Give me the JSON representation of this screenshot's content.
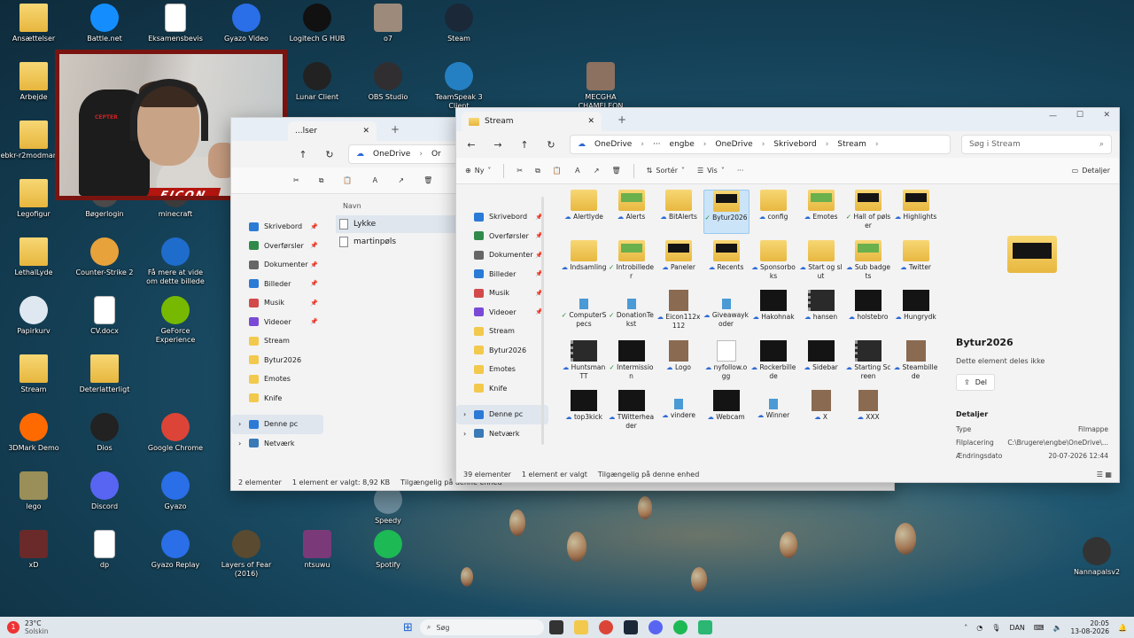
{
  "desktop": {
    "icons": [
      {
        "label": "Ansættelser",
        "kind": "folder",
        "color": "#f2c94c"
      },
      {
        "label": "Battle.net",
        "kind": "app",
        "color": "#148eff"
      },
      {
        "label": "Eksamensbevis",
        "kind": "doc",
        "color": "#ffffff"
      },
      {
        "label": "Gyazo Video",
        "kind": "app",
        "color": "#2a6ee8"
      },
      {
        "label": "Logitech G HUB",
        "kind": "app",
        "color": "#111111"
      },
      {
        "label": "o7",
        "kind": "image",
        "color": "#9d8a7a"
      },
      {
        "label": "Steam",
        "kind": "app",
        "color": "#1b2838"
      },
      {
        "label": "Arbejde",
        "kind": "folder",
        "color": "#f2c94c"
      },
      {
        "label": "Lunar Client",
        "kind": "app",
        "color": "#222222"
      },
      {
        "label": "OBS Studio",
        "kind": "app",
        "color": "#302e31"
      },
      {
        "label": "TeamSpeak 3 Client",
        "kind": "app",
        "color": "#2580c3"
      },
      {
        "label": "MECGHA CHAMELEON",
        "kind": "image",
        "color": "#8c7060"
      },
      {
        "label": "ebkr-r2modman-...",
        "kind": "folder",
        "color": "#f2c94c"
      },
      {
        "label": "Legofigur",
        "kind": "folder",
        "color": "#d9b24a"
      },
      {
        "label": "Bøgerlogin",
        "kind": "app",
        "color": "#4a4a4a"
      },
      {
        "label": "minecraft",
        "kind": "app",
        "color": "#3b3b3b"
      },
      {
        "label": "LethalLyde",
        "kind": "folder",
        "color": "#f2c94c"
      },
      {
        "label": "Counter-Strike 2",
        "kind": "app",
        "color": "#e8a23b"
      },
      {
        "label": "Få mere at vide om dette billede",
        "kind": "app",
        "color": "#1e6ccc"
      },
      {
        "label": "Papirkurv",
        "kind": "app",
        "color": "#dfe8f0"
      },
      {
        "label": "CV.docx",
        "kind": "doc",
        "color": "#ffffff"
      },
      {
        "label": "GeForce Experience",
        "kind": "app",
        "color": "#76b900"
      },
      {
        "label": "Stream",
        "kind": "folder",
        "color": "#f2c94c"
      },
      {
        "label": "Deterlatterligt",
        "kind": "folder",
        "color": "#f2c94c"
      },
      {
        "label": "3DMark Demo",
        "kind": "app",
        "color": "#ff6a00"
      },
      {
        "label": "Dios",
        "kind": "app",
        "color": "#222222"
      },
      {
        "label": "Google Chrome",
        "kind": "app",
        "color": "#db4437"
      },
      {
        "label": "lego",
        "kind": "image",
        "color": "#9a8f58"
      },
      {
        "label": "Discord",
        "kind": "app",
        "color": "#5865f2"
      },
      {
        "label": "Gyazo",
        "kind": "app",
        "color": "#2a6ee8"
      },
      {
        "label": "xD",
        "kind": "image",
        "color": "#6a2a2a"
      },
      {
        "label": "dp",
        "kind": "doc",
        "color": "#ffffff"
      },
      {
        "label": "Gyazo Replay",
        "kind": "app",
        "color": "#2a6ee8"
      },
      {
        "label": "Layers of Fear (2016)",
        "kind": "app",
        "color": "#5a4a30"
      },
      {
        "label": "ntsuwu",
        "kind": "image",
        "color": "#7a3a7a"
      },
      {
        "label": "Spotify",
        "kind": "app",
        "color": "#1db954"
      },
      {
        "label": "Speedy",
        "kind": "app",
        "color": "#6a8a9a"
      },
      {
        "label": "Nannapalsv2",
        "kind": "app",
        "color": "#333333"
      }
    ]
  },
  "webcam": {
    "tag": "EICON"
  },
  "back_window": {
    "tab_title": "...lser",
    "breadcrumb": [
      "OneDrive",
      "Or"
    ],
    "column_header": "Navn",
    "files": [
      "Lykke",
      "martinpøls"
    ],
    "sidebar": [
      {
        "label": "Skrivebord",
        "pinned": true,
        "icon": "#2a7ad6"
      },
      {
        "label": "Overførsler",
        "pinned": true,
        "icon": "#2f8a4a"
      },
      {
        "label": "Dokumenter",
        "pinned": true,
        "icon": "#666666"
      },
      {
        "label": "Billeder",
        "pinned": true,
        "icon": "#2a7ad6"
      },
      {
        "label": "Musik",
        "pinned": true,
        "icon": "#d24a4a"
      },
      {
        "label": "Videoer",
        "pinned": true,
        "icon": "#7a4ad6"
      },
      {
        "label": "Stream",
        "pinned": false,
        "icon": "#f2c94c"
      },
      {
        "label": "Bytur2026",
        "pinned": false,
        "icon": "#f2c94c"
      },
      {
        "label": "Emotes",
        "pinned": false,
        "icon": "#f2c94c"
      },
      {
        "label": "Knife",
        "pinned": false,
        "icon": "#f2c94c"
      }
    ],
    "this_pc": "Denne pc",
    "network": "Netværk",
    "status": {
      "count": "2 elementer",
      "selected": "1 element er valgt: 8,92 KB",
      "availability": "Tilgængelig på denne enhed"
    }
  },
  "window": {
    "tab_title": "Stream",
    "new_tab": "+",
    "breadcrumb": [
      "OneDrive",
      "···",
      "engbe",
      "OneDrive",
      "Skrivebord",
      "Stream"
    ],
    "search_placeholder": "Søg i Stream",
    "commands": {
      "new": "Ny",
      "sort": "Sortér",
      "view": "Vis",
      "more": "···",
      "details": "Detaljer"
    },
    "sidebar": [
      {
        "label": "Skrivebord",
        "pinned": true,
        "icon": "#2a7ad6"
      },
      {
        "label": "Overførsler",
        "pinned": true,
        "icon": "#2f8a4a"
      },
      {
        "label": "Dokumenter",
        "pinned": true,
        "icon": "#666666"
      },
      {
        "label": "Billeder",
        "pinned": true,
        "icon": "#2a7ad6"
      },
      {
        "label": "Musik",
        "pinned": true,
        "icon": "#d24a4a"
      },
      {
        "label": "Videoer",
        "pinned": true,
        "icon": "#7a4ad6"
      },
      {
        "label": "Stream",
        "pinned": false,
        "icon": "#f2c94c"
      },
      {
        "label": "Bytur2026",
        "pinned": false,
        "icon": "#f2c94c"
      },
      {
        "label": "Emotes",
        "pinned": false,
        "icon": "#f2c94c"
      },
      {
        "label": "Knife",
        "pinned": false,
        "icon": "#f2c94c"
      }
    ],
    "this_pc": "Denne pc",
    "network": "Netværk",
    "files": [
      {
        "name": "Alertlyde",
        "type": "folder",
        "status": "cloud"
      },
      {
        "name": "Alerts",
        "type": "folder-img",
        "status": "cloud"
      },
      {
        "name": "BitAlerts",
        "type": "folder",
        "status": "cloud"
      },
      {
        "name": "Bytur2026",
        "type": "folder-dark",
        "status": "check",
        "selected": true
      },
      {
        "name": "config",
        "type": "folder",
        "status": "cloud"
      },
      {
        "name": "Emotes",
        "type": "folder-img",
        "status": "cloud"
      },
      {
        "name": "Hall of pølser",
        "type": "folder-dark",
        "status": "check"
      },
      {
        "name": "Highlights",
        "type": "folder-dark",
        "status": "cloud"
      },
      {
        "name": "Indsamling",
        "type": "folder",
        "status": "cloud"
      },
      {
        "name": "Introbilleder",
        "type": "folder-img",
        "status": "check"
      },
      {
        "name": "Paneler",
        "type": "folder-dark",
        "status": "cloud"
      },
      {
        "name": "Recents",
        "type": "folder-dark",
        "status": "cloud"
      },
      {
        "name": "Sponsorboks",
        "type": "folder",
        "status": "cloud"
      },
      {
        "name": "Start og slut",
        "type": "folder",
        "status": "cloud"
      },
      {
        "name": "Sub badgets",
        "type": "folder-img",
        "status": "cloud"
      },
      {
        "name": "Twitter",
        "type": "folder",
        "status": "cloud"
      },
      {
        "name": "ComputerSpecs",
        "type": "file",
        "status": "check"
      },
      {
        "name": "DonationTekst",
        "type": "file",
        "status": "check"
      },
      {
        "name": "Eicon112x112",
        "type": "image",
        "status": "cloud"
      },
      {
        "name": "Giveawaykoder",
        "type": "file",
        "status": "cloud"
      },
      {
        "name": "Hakohnak",
        "type": "dark",
        "status": "cloud"
      },
      {
        "name": "hansen",
        "type": "video",
        "status": "cloud"
      },
      {
        "name": "holstebro",
        "type": "dark",
        "status": "cloud"
      },
      {
        "name": "Hungrydk",
        "type": "dark",
        "status": "cloud"
      },
      {
        "name": "Huntsman TT",
        "type": "video",
        "status": "cloud"
      },
      {
        "name": "Intermission",
        "type": "dark",
        "status": "check"
      },
      {
        "name": "Logo",
        "type": "image",
        "status": "cloud"
      },
      {
        "name": "nyfollow.ogg",
        "type": "doc",
        "status": "cloud"
      },
      {
        "name": "Rockerbillede",
        "type": "dark",
        "status": "cloud"
      },
      {
        "name": "Sidebar",
        "type": "dark",
        "status": "cloud"
      },
      {
        "name": "Starting Screen",
        "type": "video",
        "status": "cloud"
      },
      {
        "name": "Steambillede",
        "type": "image",
        "status": "cloud"
      },
      {
        "name": "top3kick",
        "type": "dark",
        "status": "cloud"
      },
      {
        "name": "TWitterheader",
        "type": "dark",
        "status": "cloud"
      },
      {
        "name": "vindere",
        "type": "file",
        "status": "cloud"
      },
      {
        "name": "Webcam",
        "type": "dark",
        "status": "cloud"
      },
      {
        "name": "Winner",
        "type": "file",
        "status": "cloud"
      },
      {
        "name": "X",
        "type": "image",
        "status": "cloud"
      },
      {
        "name": "XXX",
        "type": "image",
        "status": "cloud"
      }
    ],
    "details": {
      "title": "Bytur2026",
      "share_status": "Dette element deles ikke",
      "share_button": "Del",
      "section": "Detaljer",
      "rows": [
        {
          "key": "Type",
          "value": "Filmappe"
        },
        {
          "key": "Filplacering",
          "value": "C:\\Brugere\\engbe\\OneDrive\\..."
        },
        {
          "key": "Ændringsdato",
          "value": "20-07-2026 12:44"
        }
      ]
    },
    "status": {
      "count": "39 elementer",
      "selected": "1 element er valgt",
      "availability": "Tilgængelig på denne enhed"
    }
  },
  "taskbar": {
    "weather_temp": "23°C",
    "weather_desc": "Solskin",
    "search": "Søg",
    "lang": "DAN",
    "time": "20:05",
    "date": "13-08-2026",
    "notification_count": "1"
  }
}
